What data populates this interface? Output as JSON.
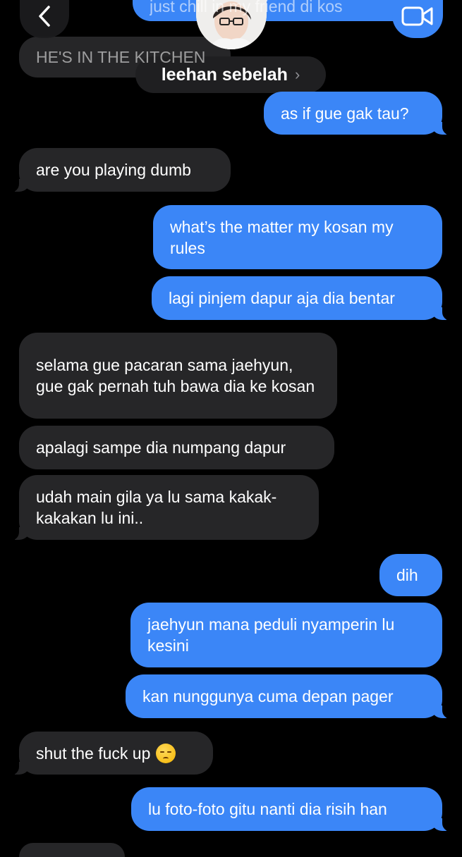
{
  "header": {
    "contact_name": "leehan sebelah",
    "chevron": "›",
    "back_icon": "chevron-left-icon",
    "video_icon": "video-camera-icon"
  },
  "top_partial": {
    "outgoing_text": "just chill in my friend di kos",
    "incoming_text": "HE'S IN THE KITCHEN"
  },
  "messages": [
    {
      "dir": "out",
      "text": "as if gue gak tau?"
    },
    {
      "dir": "in",
      "text": "are you playing dumb"
    },
    {
      "dir": "out",
      "text": "what’s the matter my kosan my rules"
    },
    {
      "dir": "out",
      "text": "lagi pinjem dapur aja dia bentar"
    },
    {
      "dir": "in",
      "text": "selama gue pacaran sama jaehyun, gue gak pernah tuh bawa dia ke kosan"
    },
    {
      "dir": "in",
      "text": "apalagi sampe dia numpang dapur"
    },
    {
      "dir": "in",
      "text": "udah main gila ya lu sama kakak-kakakan lu ini.."
    },
    {
      "dir": "out",
      "text": "dih"
    },
    {
      "dir": "out",
      "text": "jaehyun mana peduli nyamperin lu kesini"
    },
    {
      "dir": "out",
      "text": "kan nunggunya cuma depan pager"
    },
    {
      "dir": "in",
      "text": "shut the fuck up",
      "emoji": "pensive-face-emoji"
    },
    {
      "dir": "out",
      "text": "lu foto-foto gitu nanti dia risih han"
    }
  ],
  "colors": {
    "incoming_bubble": "#262628",
    "outgoing_bubble": "#3b86f7",
    "background": "#000000"
  }
}
